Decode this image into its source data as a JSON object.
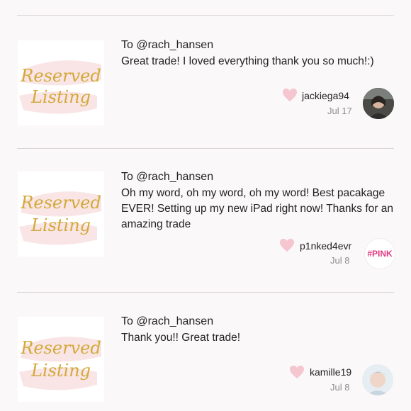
{
  "reviews": [
    {
      "thumbnail": {
        "line1": "Reserved",
        "line2": "Listing"
      },
      "to": "To @rach_hansen",
      "message": "Great trade! I loved everything thank you so much!:)",
      "username": "jackiega94",
      "date": "Jul 17",
      "avatar_icon": "profile-photo"
    },
    {
      "thumbnail": {
        "line1": "Reserved",
        "line2": "Listing"
      },
      "to": "To @rach_hansen",
      "message": "Oh my word, oh my word, oh my word! Best pacakage EVER! Setting up my new iPad right now! Thanks for an amazing trade",
      "username": "p1nked4evr",
      "date": "Jul 8",
      "avatar_text": "#PINK"
    },
    {
      "thumbnail": {
        "line1": "Reserved",
        "line2": "Listing"
      },
      "to": "To @rach_hansen",
      "message": "Thank you!! Great trade!",
      "username": "kamille19",
      "date": "Jul 8",
      "avatar_icon": "profile-photo"
    }
  ],
  "colors": {
    "heart": "#f5c6cf",
    "accent_pink": "#e0387f",
    "gold": "#d4a93a"
  }
}
